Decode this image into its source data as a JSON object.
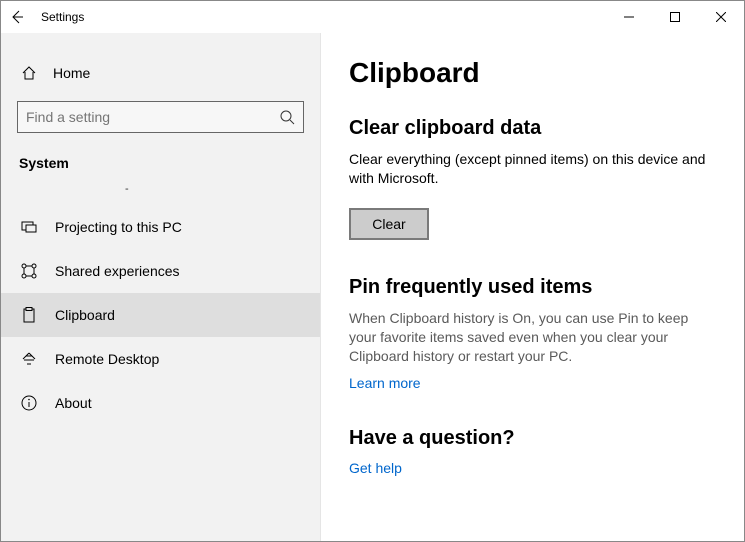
{
  "titlebar": {
    "title": "Settings"
  },
  "sidebar": {
    "home": "Home",
    "search_placeholder": "Find a setting",
    "category": "System",
    "items": [
      {
        "label": "Projecting to this PC"
      },
      {
        "label": "Shared experiences"
      },
      {
        "label": "Clipboard"
      },
      {
        "label": "Remote Desktop"
      },
      {
        "label": "About"
      }
    ]
  },
  "content": {
    "title": "Clipboard",
    "clear": {
      "heading": "Clear clipboard data",
      "text": "Clear everything (except pinned items) on this device and with Microsoft.",
      "button": "Clear"
    },
    "pin": {
      "heading": "Pin frequently used items",
      "text": "When Clipboard history is On, you can use Pin to keep your favorite items saved even when you clear your Clipboard history or restart your PC.",
      "link": "Learn more"
    },
    "question": {
      "heading": "Have a question?",
      "link": "Get help"
    }
  }
}
